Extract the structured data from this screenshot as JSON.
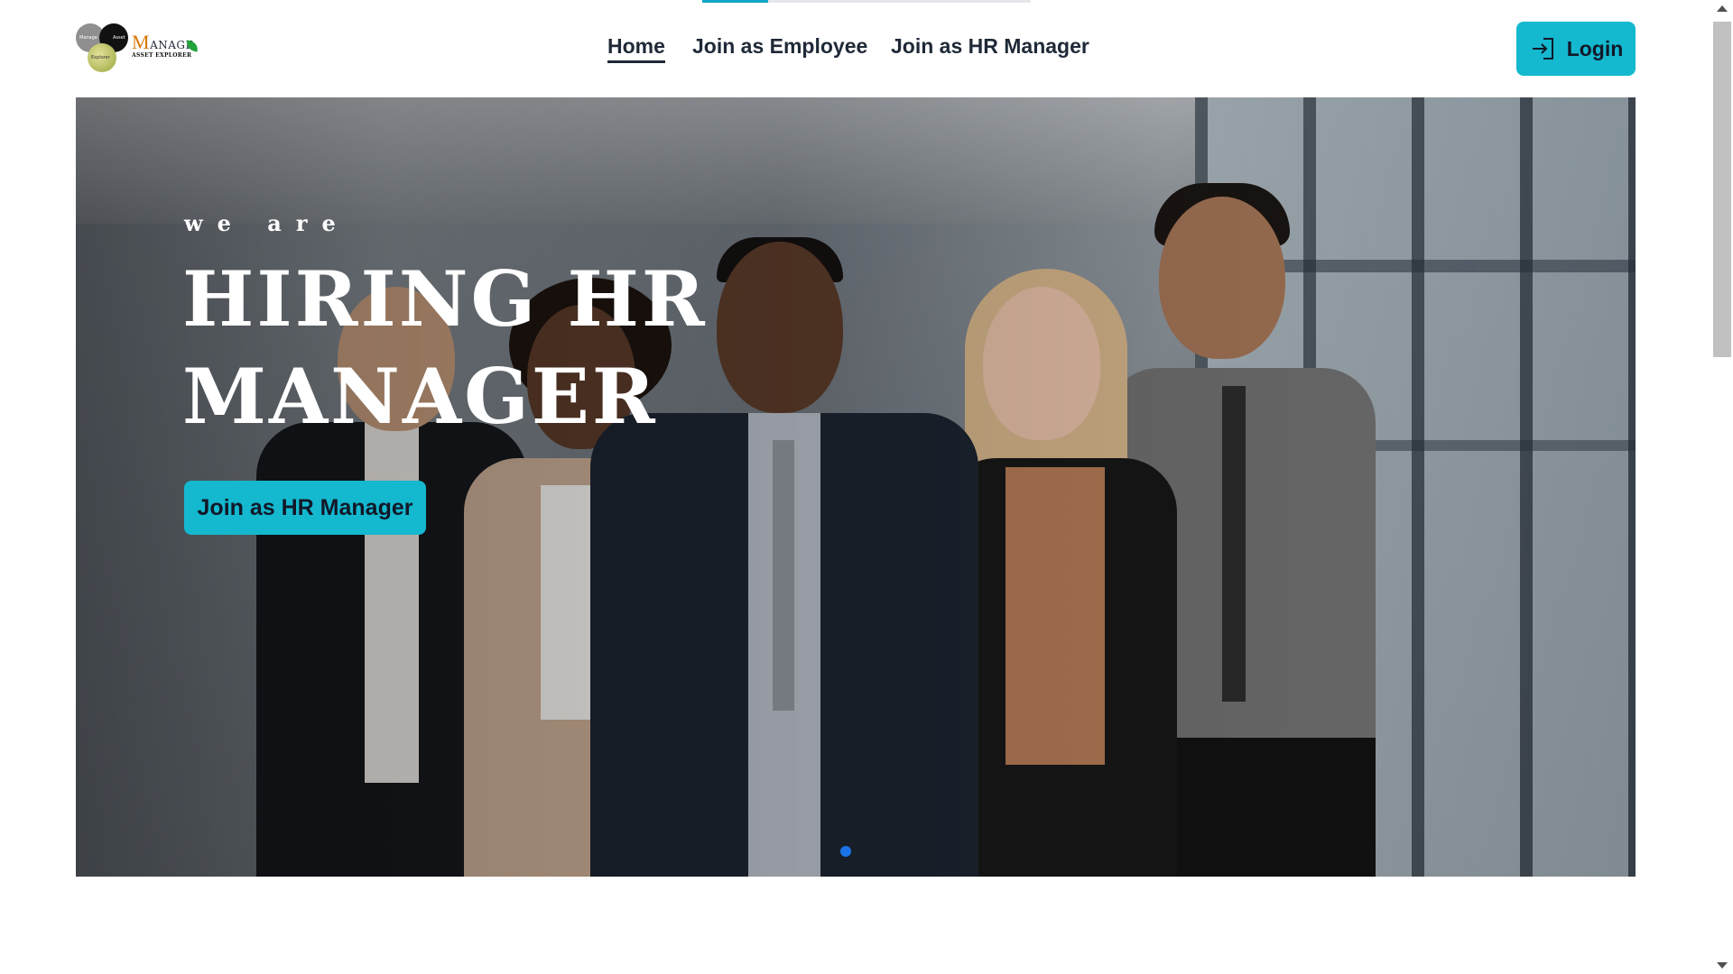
{
  "logo": {
    "circle_1_text": "Manage",
    "circle_2_text": "Asset",
    "circle_3_text": "Explorer",
    "brand_initial": "M",
    "brand_rest": "ANAGE",
    "brand_sub": "ASSET EXPLORER"
  },
  "nav": {
    "items": [
      {
        "label": "Home",
        "active": true
      },
      {
        "label": "Join as Employee",
        "active": false
      },
      {
        "label": "Join as HR Manager",
        "active": false
      }
    ],
    "login_label": "Login",
    "login_icon": "login-arrow-icon"
  },
  "hero": {
    "eyebrow": "we are",
    "title": "HIRING HR MANAGER",
    "cta_label": "Join as HR Manager",
    "slide_count": 1,
    "active_slide": 1
  },
  "colors": {
    "accent": "#14b8cf",
    "text": "#1f2937",
    "dot": "#1a73e8"
  }
}
